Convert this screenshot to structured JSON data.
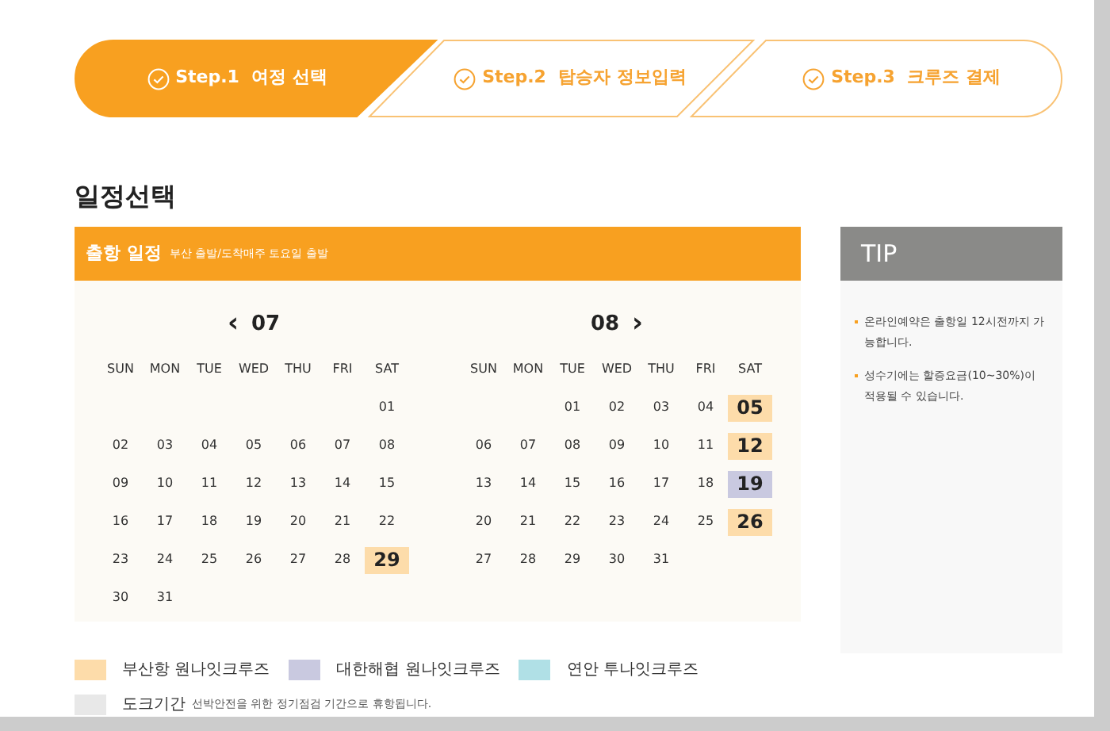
{
  "steps": [
    {
      "label": "Step.1  여정 선택",
      "selected": true
    },
    {
      "label": "Step.2  탑승자 정보입력",
      "selected": false
    },
    {
      "label": "Step.3  크루즈 결제",
      "selected": false
    }
  ],
  "page_title": "일정선택",
  "schedule": {
    "title": "출항 일정",
    "subtitle": "부산 출발/도착매주 토요일 출발",
    "months": [
      {
        "prev": "‹",
        "label": "07",
        "weekdays": [
          "SUN",
          "MON",
          "TUE",
          "WED",
          "THU",
          "FRI",
          "SAT"
        ],
        "weeks": [
          [
            {
              "kind": "empty"
            },
            {
              "kind": "empty"
            },
            {
              "kind": "empty"
            },
            {
              "kind": "empty"
            },
            {
              "kind": "empty"
            },
            {
              "kind": "empty"
            },
            {
              "kind": "day",
              "day": "01"
            }
          ],
          [
            {
              "kind": "day",
              "day": "02"
            },
            {
              "kind": "day",
              "day": "03"
            },
            {
              "kind": "day",
              "day": "04"
            },
            {
              "kind": "day",
              "day": "05"
            },
            {
              "kind": "day",
              "day": "06"
            },
            {
              "kind": "day",
              "day": "07"
            },
            {
              "kind": "day",
              "day": "08"
            }
          ],
          [
            {
              "kind": "day",
              "day": "09"
            },
            {
              "kind": "day",
              "day": "10"
            },
            {
              "kind": "day",
              "day": "11"
            },
            {
              "kind": "day",
              "day": "12"
            },
            {
              "kind": "day",
              "day": "13"
            },
            {
              "kind": "day",
              "day": "14"
            },
            {
              "kind": "day",
              "day": "15"
            }
          ],
          [
            {
              "kind": "day",
              "day": "16"
            },
            {
              "kind": "day",
              "day": "17"
            },
            {
              "kind": "day",
              "day": "18"
            },
            {
              "kind": "day",
              "day": "19"
            },
            {
              "kind": "day",
              "day": "20"
            },
            {
              "kind": "day",
              "day": "21"
            },
            {
              "kind": "day",
              "day": "22"
            }
          ],
          [
            {
              "kind": "day",
              "day": "23"
            },
            {
              "kind": "day",
              "day": "24"
            },
            {
              "kind": "day",
              "day": "25"
            },
            {
              "kind": "day",
              "day": "26"
            },
            {
              "kind": "day",
              "day": "27"
            },
            {
              "kind": "day",
              "day": "28"
            },
            {
              "kind": "day",
              "day": "29",
              "color": "#fddcaa"
            }
          ],
          [
            {
              "kind": "day",
              "day": "30"
            },
            {
              "kind": "day",
              "day": "31"
            },
            {
              "kind": "empty"
            },
            {
              "kind": "empty"
            },
            {
              "kind": "empty"
            },
            {
              "kind": "empty"
            },
            {
              "kind": "empty"
            }
          ]
        ]
      },
      {
        "label": "08",
        "next": "›",
        "weekdays": [
          "SUN",
          "MON",
          "TUE",
          "WED",
          "THU",
          "FRI",
          "SAT"
        ],
        "weeks": [
          [
            {
              "kind": "empty"
            },
            {
              "kind": "empty"
            },
            {
              "kind": "day",
              "day": "01"
            },
            {
              "kind": "day",
              "day": "02"
            },
            {
              "kind": "day",
              "day": "03"
            },
            {
              "kind": "day",
              "day": "04"
            },
            {
              "kind": "day",
              "day": "05",
              "color": "#fddcaa"
            }
          ],
          [
            {
              "kind": "day",
              "day": "06"
            },
            {
              "kind": "day",
              "day": "07"
            },
            {
              "kind": "day",
              "day": "08"
            },
            {
              "kind": "day",
              "day": "09"
            },
            {
              "kind": "day",
              "day": "10"
            },
            {
              "kind": "day",
              "day": "11"
            },
            {
              "kind": "day",
              "day": "12",
              "color": "#fddcaa"
            }
          ],
          [
            {
              "kind": "day",
              "day": "13"
            },
            {
              "kind": "day",
              "day": "14"
            },
            {
              "kind": "day",
              "day": "15"
            },
            {
              "kind": "day",
              "day": "16"
            },
            {
              "kind": "day",
              "day": "17"
            },
            {
              "kind": "day",
              "day": "18"
            },
            {
              "kind": "day",
              "day": "19",
              "color": "#c9c9e0"
            }
          ],
          [
            {
              "kind": "day",
              "day": "20"
            },
            {
              "kind": "day",
              "day": "21"
            },
            {
              "kind": "day",
              "day": "22"
            },
            {
              "kind": "day",
              "day": "23"
            },
            {
              "kind": "day",
              "day": "24"
            },
            {
              "kind": "day",
              "day": "25"
            },
            {
              "kind": "day",
              "day": "26",
              "color": "#fddcaa"
            }
          ],
          [
            {
              "kind": "day",
              "day": "27"
            },
            {
              "kind": "day",
              "day": "28"
            },
            {
              "kind": "day",
              "day": "29"
            },
            {
              "kind": "day",
              "day": "30"
            },
            {
              "kind": "day",
              "day": "31"
            },
            {
              "kind": "empty"
            },
            {
              "kind": "empty"
            }
          ]
        ]
      }
    ]
  },
  "tip": {
    "title": "TIP",
    "items": [
      "온라인예약은 출항일 12시전까지 가능합니다.",
      "성수기에는 할증요금(10~30%)이 적용될 수 있습니다."
    ]
  },
  "legend": [
    {
      "label": "부산항 원나잇크루즈",
      "color": "#fddcaa"
    },
    {
      "label": "대한해협 원나잇크루즈",
      "color": "#c9c9e0"
    },
    {
      "label": "연안 투나잇크루즈",
      "color": "#b0e0e6"
    },
    {
      "label": "도크기간",
      "color": "#e8e8e8",
      "note": "선박안전을 위한 정기점검 기간으로 휴항됩니다."
    }
  ]
}
